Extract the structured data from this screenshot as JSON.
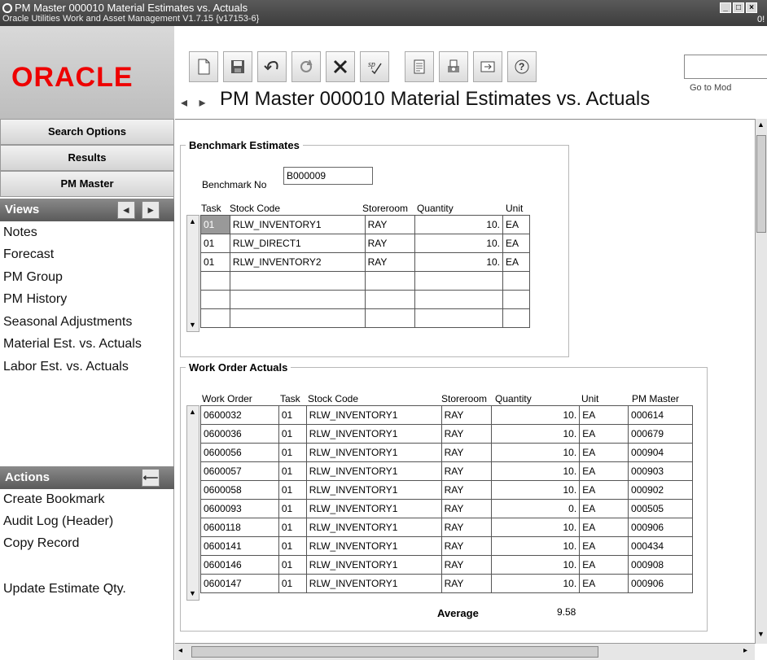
{
  "window": {
    "title": "PM Master 000010 Material Estimates vs. Actuals",
    "subtitle": "Oracle Utilities Work and Asset Management V1.7.15 {v17153-6}",
    "right_fragment": "0!"
  },
  "logo_text": "ORACLE",
  "toolbar": {
    "goto_label": "Go to Mod",
    "icons": [
      "new-document-icon",
      "save-icon",
      "undo-icon",
      "refresh-icon",
      "delete-icon",
      "special-icon",
      "report-icon",
      "print-icon",
      "link-icon",
      "help-icon"
    ]
  },
  "page_title": "PM Master 000010 Material Estimates vs. Actuals",
  "sidebar": {
    "search_options": "Search Options",
    "results": "Results",
    "pm_master": "PM Master",
    "views_header": "Views",
    "views": [
      "Notes",
      "Forecast",
      "PM Group",
      "PM History",
      "Seasonal Adjustments",
      "Material Est. vs. Actuals",
      "Labor Est. vs. Actuals"
    ],
    "actions_header": "Actions",
    "actions": [
      "Create Bookmark",
      "Audit Log (Header)",
      "Copy Record",
      "Update Estimate Qty."
    ]
  },
  "benchmark": {
    "legend": "Benchmark Estimates",
    "benchmark_no_label": "Benchmark No",
    "benchmark_no_value": "B000009",
    "columns": [
      "Task",
      "Stock Code",
      "Storeroom",
      "Quantity",
      "Unit"
    ],
    "rows": [
      {
        "task": "01",
        "stock": "RLW_INVENTORY1",
        "store": "RAY",
        "qty": "10.",
        "unit": "EA"
      },
      {
        "task": "01",
        "stock": "RLW_DIRECT1",
        "store": "RAY",
        "qty": "10.",
        "unit": "EA"
      },
      {
        "task": "01",
        "stock": "RLW_INVENTORY2",
        "store": "RAY",
        "qty": "10.",
        "unit": "EA"
      }
    ]
  },
  "actuals": {
    "legend": "Work Order Actuals",
    "columns": [
      "Work Order",
      "Task",
      "Stock Code",
      "Storeroom",
      "Quantity",
      "Unit",
      "PM Master"
    ],
    "rows": [
      {
        "wo": "0600032",
        "task": "01",
        "stock": "RLW_INVENTORY1",
        "store": "RAY",
        "qty": "10.",
        "unit": "EA",
        "pm": "000614"
      },
      {
        "wo": "0600036",
        "task": "01",
        "stock": "RLW_INVENTORY1",
        "store": "RAY",
        "qty": "10.",
        "unit": "EA",
        "pm": "000679"
      },
      {
        "wo": "0600056",
        "task": "01",
        "stock": "RLW_INVENTORY1",
        "store": "RAY",
        "qty": "10.",
        "unit": "EA",
        "pm": "000904"
      },
      {
        "wo": "0600057",
        "task": "01",
        "stock": "RLW_INVENTORY1",
        "store": "RAY",
        "qty": "10.",
        "unit": "EA",
        "pm": "000903"
      },
      {
        "wo": "0600058",
        "task": "01",
        "stock": "RLW_INVENTORY1",
        "store": "RAY",
        "qty": "10.",
        "unit": "EA",
        "pm": "000902"
      },
      {
        "wo": "0600093",
        "task": "01",
        "stock": "RLW_INVENTORY1",
        "store": "RAY",
        "qty": "0.",
        "unit": "EA",
        "pm": "000505"
      },
      {
        "wo": "0600118",
        "task": "01",
        "stock": "RLW_INVENTORY1",
        "store": "RAY",
        "qty": "10.",
        "unit": "EA",
        "pm": "000906"
      },
      {
        "wo": "0600141",
        "task": "01",
        "stock": "RLW_INVENTORY1",
        "store": "RAY",
        "qty": "10.",
        "unit": "EA",
        "pm": "000434"
      },
      {
        "wo": "0600146",
        "task": "01",
        "stock": "RLW_INVENTORY1",
        "store": "RAY",
        "qty": "10.",
        "unit": "EA",
        "pm": "000908"
      },
      {
        "wo": "0600147",
        "task": "01",
        "stock": "RLW_INVENTORY1",
        "store": "RAY",
        "qty": "10.",
        "unit": "EA",
        "pm": "000906"
      }
    ],
    "average_label": "Average",
    "average_value": "9.58"
  }
}
